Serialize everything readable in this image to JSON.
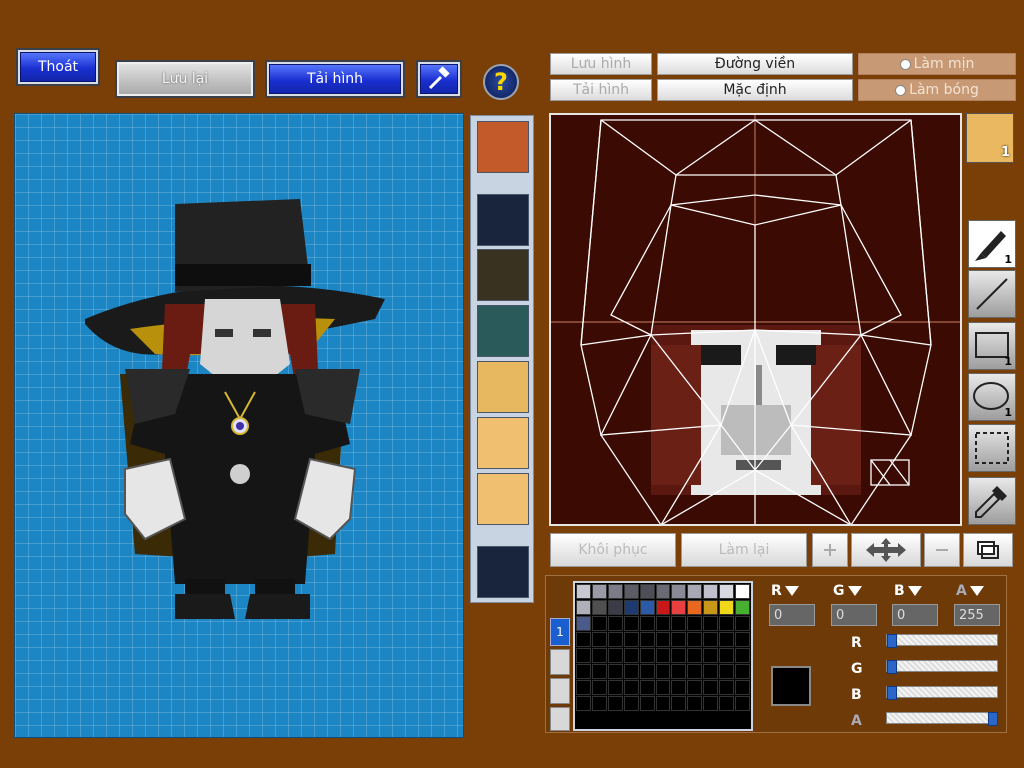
{
  "toolbar": {
    "exit_label": "Thoát",
    "save_label": "Lưu lại",
    "reload_label": "Tải hình",
    "help_glyph": "?"
  },
  "editor_tabs": {
    "save_image": "Lưu hình",
    "load_image": "Tải hình",
    "outline": "Đường viền",
    "default": "Mặc định",
    "smooth": "Làm mịn",
    "shade": "Làm bóng"
  },
  "face_slot_badge": "1",
  "tools": [
    {
      "name": "pen",
      "badge": "1"
    },
    {
      "name": "line",
      "badge": ""
    },
    {
      "name": "rectangle",
      "badge": "1"
    },
    {
      "name": "ellipse",
      "badge": "1"
    },
    {
      "name": "selection",
      "badge": ""
    },
    {
      "name": "eyedropper",
      "badge": ""
    }
  ],
  "bottom_buttons": {
    "restore": "Khôi phục",
    "redo": "Làm lại"
  },
  "palette": {
    "tab_label": "1",
    "colors": [
      "#c8c8d0",
      "#9a9aa6",
      "#7c7c88",
      "#5c5c66",
      "#4e4e58",
      "#6a6a74",
      "#8a8a96",
      "#a8a8b4",
      "#c0c0cc",
      "#d8d8e0",
      "#ffffff",
      "#b0b0b8",
      "#505050",
      "#3c3c48",
      "#1e3a70",
      "#2a5aa8",
      "#c81818",
      "#e84040",
      "#e86820",
      "#c89818",
      "#f0d818",
      "#48b030",
      "#4a5a8a"
    ]
  },
  "channels": {
    "r": {
      "label": "R",
      "value": "0"
    },
    "g": {
      "label": "G",
      "value": "0"
    },
    "b": {
      "label": "B",
      "value": "0"
    },
    "a": {
      "label": "A",
      "value": "255"
    }
  },
  "sliders": [
    {
      "label": "R",
      "fraction": 0.0
    },
    {
      "label": "G",
      "fraction": 0.0
    },
    {
      "label": "B",
      "fraction": 0.0
    },
    {
      "label": "A",
      "fraction": 1.0
    }
  ],
  "current_color": "#000000"
}
